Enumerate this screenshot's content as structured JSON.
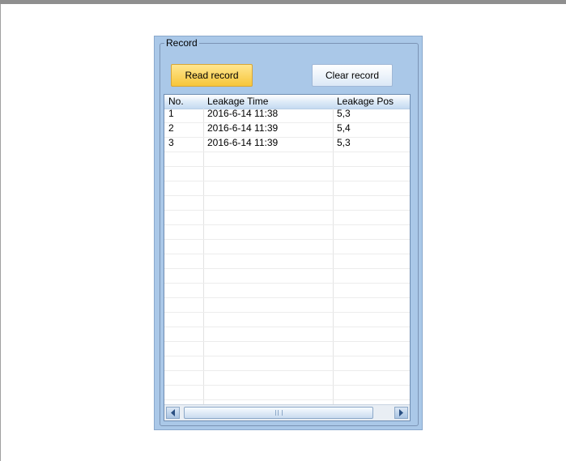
{
  "record_group": {
    "title": "Record",
    "read_button": "Read record",
    "clear_button": "Clear record"
  },
  "table": {
    "columns": [
      "No.",
      "Leakage Time",
      "Leakage Pos"
    ],
    "rows": [
      [
        "1",
        "2016-6-14 11:38",
        "5,3"
      ],
      [
        "2",
        "2016-6-14 11:39",
        "5,4"
      ],
      [
        "3",
        "2016-6-14 11:39",
        "5,3"
      ]
    ]
  },
  "icons": {
    "scroll_left": "scroll-left-arrow",
    "scroll_right": "scroll-right-arrow",
    "scroll_grip": "scroll-grip"
  },
  "colors": {
    "panel_bg": "#aac8e8",
    "read_button": "#f7c63a",
    "header_bg": "#dbe9f7"
  }
}
